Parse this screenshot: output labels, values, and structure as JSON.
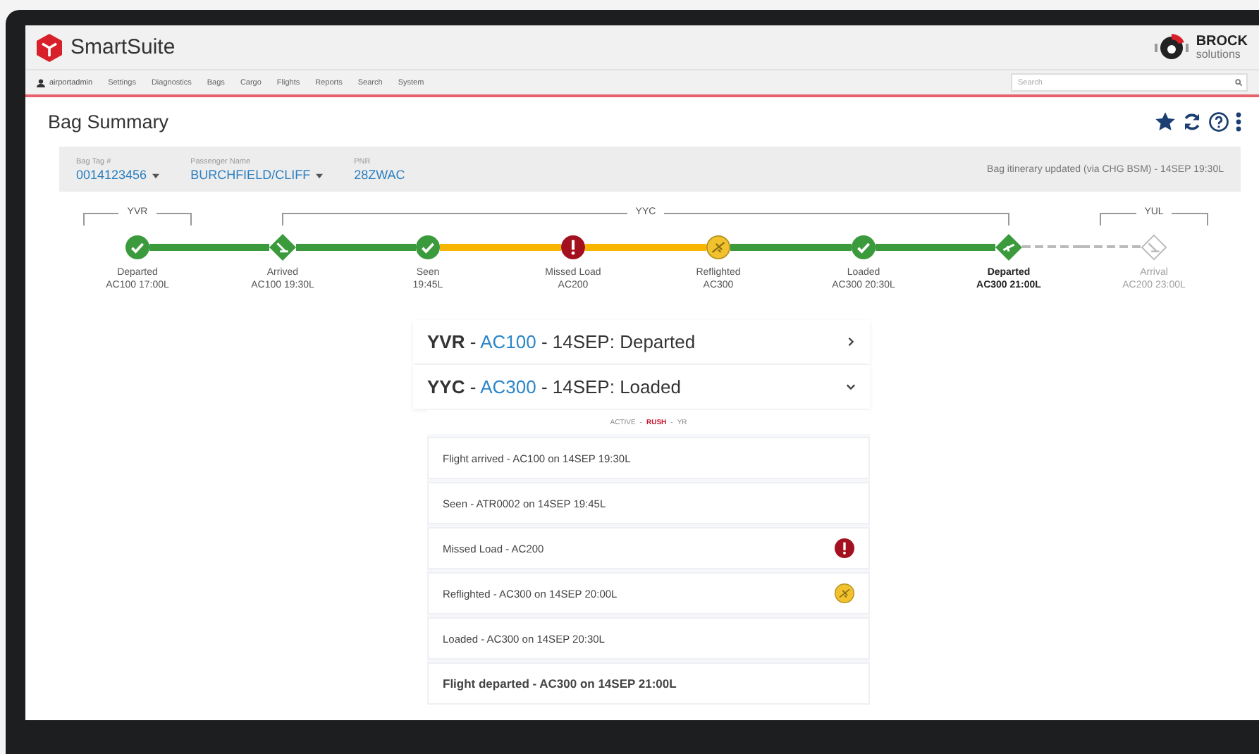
{
  "header": {
    "app_name": "SmartSuite",
    "brand": [
      "BROCK",
      "solutions"
    ]
  },
  "nav": {
    "user": "airportadmin",
    "items": [
      "Settings",
      "Diagnostics",
      "Bags",
      "Cargo",
      "Flights",
      "Reports",
      "Search",
      "System"
    ],
    "search": {
      "placeholder": "Search"
    }
  },
  "page": {
    "title": "Bag Summary"
  },
  "info": {
    "fields": [
      {
        "label": "Bag Tag #",
        "value": "0014123456",
        "dropdown": true
      },
      {
        "label": "Passenger Name",
        "value": "BURCHFIELD/CLIFF",
        "dropdown": true
      },
      {
        "label": "PNR",
        "value": "28ZWAC",
        "dropdown": false
      }
    ],
    "updated": "Bag itinerary updated (via CHG BSM) - 14SEP 19:30L"
  },
  "timeline": {
    "stations": [
      {
        "label": "YVR",
        "events": [
          {
            "kind": "check",
            "label": "Departed",
            "detail": "AC100 17:00L",
            "warning": false,
            "emphasis": false
          }
        ]
      },
      {
        "label": "YYC",
        "events": [
          {
            "kind": "arrived",
            "label": "Arrived",
            "detail": "AC100 19:30L",
            "warning": false,
            "emphasis": false
          },
          {
            "kind": "check",
            "label": "Seen",
            "detail": "19:45L",
            "warning": true,
            "emphasis": false
          },
          {
            "kind": "error",
            "label": "Missed Load",
            "detail": "AC200",
            "warning": true,
            "emphasis": false
          },
          {
            "kind": "reflight",
            "label": "Reflighted",
            "detail": "AC300",
            "warning": false,
            "emphasis": false
          },
          {
            "kind": "check",
            "label": "Loaded",
            "detail": "AC300 20:30L",
            "warning": false,
            "emphasis": false
          },
          {
            "kind": "departed",
            "label": "Departed",
            "detail": "AC300 21:00L",
            "emphasis": true
          }
        ]
      },
      {
        "label": "YUL",
        "events": [
          {
            "kind": "pending",
            "label": "Arrival",
            "detail": "AC200 23:00L",
            "emphasis": false
          }
        ]
      }
    ]
  },
  "legs": [
    {
      "parts": [
        {
          "text": "YVR",
          "link": false,
          "bold": true
        },
        {
          "text": " - ",
          "link": false,
          "bold": false
        },
        {
          "text": "AC100",
          "link": true,
          "bold": false
        },
        {
          "text": " - 14SEP: Departed",
          "link": false,
          "bold": false
        }
      ],
      "expanded": false
    },
    {
      "parts": [
        {
          "text": "YYC",
          "link": false,
          "bold": true
        },
        {
          "text": " - ",
          "link": false,
          "bold": false
        },
        {
          "text": "AC300",
          "link": true,
          "bold": false
        },
        {
          "text": " - 14SEP: Loaded",
          "link": false,
          "bold": false
        }
      ],
      "expanded": true,
      "tags": [
        {
          "text": "ACTIVE",
          "highlight": false
        },
        {
          "text": "-",
          "highlight": false
        },
        {
          "text": "RUSH",
          "highlight": true
        },
        {
          "text": "-",
          "highlight": false
        },
        {
          "text": "YR",
          "highlight": false
        }
      ],
      "events": [
        {
          "text": "Flight arrived - AC100 on 14SEP 19:30L",
          "kind": "plain",
          "bold": false
        },
        {
          "text": "Seen - ATR0002 on 14SEP 19:45L",
          "kind": "plain",
          "bold": false
        },
        {
          "text": "Missed Load - AC200",
          "kind": "error",
          "bold": false
        },
        {
          "text": "Reflighted - AC300 on 14SEP 20:00L",
          "kind": "reflight",
          "bold": false
        },
        {
          "text": "Loaded - AC300 on 14SEP 20:30L",
          "kind": "plain",
          "bold": false
        },
        {
          "text": "Flight departed - AC300 on 14SEP 21:00L",
          "kind": "plain",
          "bold": true
        }
      ]
    }
  ]
}
